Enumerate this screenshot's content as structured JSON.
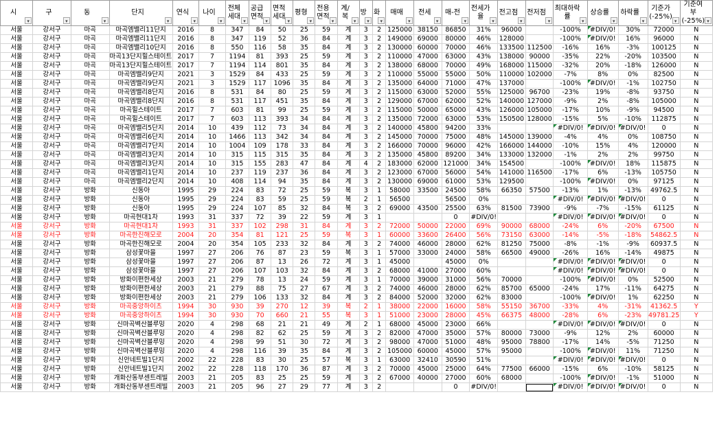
{
  "colors": {
    "red_row": "#ff1a1a",
    "error_marker": "#1e8a3b",
    "grid": "#d4d4d4"
  },
  "headers": [
    "시",
    "구",
    "동",
    "단지",
    "연식",
    "나이",
    "전체세대",
    "공급면적",
    "면적세대",
    "평형",
    "전용면적",
    "계/복",
    "방",
    "화",
    "매매",
    "전세",
    "매-전",
    "전세가율",
    "전고점",
    "전저점",
    "최대하락률",
    "상승률",
    "하락률",
    "기준가(-25%)",
    "기준여부(-25%)"
  ],
  "rows": [
    [
      "서울",
      "강서구",
      "마곡",
      "마곡엠밸리11단지",
      "2016",
      "8",
      "347",
      "84",
      "50",
      "25",
      "59",
      "계",
      "3",
      "2",
      "125000",
      "38150",
      "86850",
      "31%",
      "96000",
      "",
      "-100%",
      "#DIV/0!",
      "30%",
      "72000",
      "N"
    ],
    [
      "서울",
      "강서구",
      "마곡",
      "마곡엠밸리11단지",
      "2016",
      "8",
      "347",
      "119",
      "52",
      "36",
      "84",
      "계",
      "3",
      "2",
      "149000",
      "69000",
      "80000",
      "46%",
      "128000",
      "",
      "-100%",
      "#DIV/0!",
      "16%",
      "96000",
      "N"
    ],
    [
      "서울",
      "강서구",
      "마곡",
      "마곡엠밸리10단지",
      "2016",
      "8",
      "550",
      "116",
      "58",
      "35",
      "84",
      "계",
      "3",
      "2",
      "130000",
      "60000",
      "70000",
      "46%",
      "133500",
      "112500",
      "-16%",
      "16%",
      "-3%",
      "100125",
      "N"
    ],
    [
      "서울",
      "강서구",
      "마곡",
      "마곡13단지힐스테이트마스터",
      "2017",
      "7",
      "1194",
      "81",
      "393",
      "25",
      "59",
      "계",
      "3",
      "2",
      "110000",
      "47000",
      "63000",
      "43%",
      "138000",
      "90000",
      "-35%",
      "22%",
      "-20%",
      "103500",
      "N"
    ],
    [
      "서울",
      "강서구",
      "마곡",
      "마곡13단지힐스테이트마스터",
      "2017",
      "7",
      "1194",
      "114",
      "801",
      "35",
      "84",
      "계",
      "3",
      "2",
      "138000",
      "68000",
      "70000",
      "49%",
      "168000",
      "115000",
      "-32%",
      "20%",
      "-18%",
      "126000",
      "N"
    ],
    [
      "서울",
      "강서구",
      "마곡",
      "마곡엠밸리9단지",
      "2021",
      "3",
      "1529",
      "84",
      "433",
      "25",
      "59",
      "계",
      "3",
      "2",
      "110000",
      "55000",
      "55000",
      "50%",
      "110000",
      "102000",
      "-7%",
      "8%",
      "0%",
      "82500",
      "N"
    ],
    [
      "서울",
      "강서구",
      "마곡",
      "마곡엠밸리9단지",
      "2021",
      "3",
      "1529",
      "117",
      "1096",
      "35",
      "84",
      "계",
      "3",
      "2",
      "135000",
      "64000",
      "71000",
      "47%",
      "137000",
      "",
      "-100%",
      "#DIV/0!",
      "-1%",
      "102750",
      "N"
    ],
    [
      "서울",
      "강서구",
      "마곡",
      "마곡엠밸리8단지",
      "2016",
      "8",
      "531",
      "84",
      "80",
      "25",
      "59",
      "계",
      "3",
      "2",
      "115000",
      "63000",
      "52000",
      "55%",
      "125000",
      "96700",
      "-23%",
      "19%",
      "-8%",
      "93750",
      "N"
    ],
    [
      "서울",
      "강서구",
      "마곡",
      "마곡엠밸리8단지",
      "2016",
      "8",
      "531",
      "117",
      "451",
      "35",
      "84",
      "계",
      "3",
      "2",
      "129000",
      "67000",
      "62000",
      "52%",
      "140000",
      "127000",
      "-9%",
      "2%",
      "-8%",
      "105000",
      "N"
    ],
    [
      "서울",
      "강서구",
      "마곡",
      "마곡힐스테이트",
      "2017",
      "7",
      "603",
      "81",
      "99",
      "25",
      "59",
      "계",
      "3",
      "2",
      "115000",
      "50000",
      "65000",
      "43%",
      "126000",
      "105000",
      "-17%",
      "10%",
      "-9%",
      "94500",
      "N"
    ],
    [
      "서울",
      "강서구",
      "마곡",
      "마곡힐스테이트",
      "2017",
      "7",
      "603",
      "113",
      "393",
      "34",
      "84",
      "계",
      "3",
      "2",
      "135000",
      "72000",
      "63000",
      "53%",
      "150500",
      "128000",
      "-15%",
      "5%",
      "-10%",
      "112875",
      "N"
    ],
    [
      "서울",
      "강서구",
      "마곡",
      "마곡엠밸리5단지",
      "2014",
      "10",
      "439",
      "112",
      "73",
      "34",
      "84",
      "계",
      "3",
      "2",
      "140000",
      "45800",
      "94200",
      "33%",
      "",
      "",
      "#DIV/0!",
      "#DIV/0!",
      "#DIV/0!",
      "0",
      "N"
    ],
    [
      "서울",
      "강서구",
      "마곡",
      "마곡엠밸리6단지",
      "2014",
      "10",
      "1466",
      "113",
      "342",
      "34",
      "84",
      "계",
      "3",
      "2",
      "145000",
      "70000",
      "75000",
      "48%",
      "145000",
      "139000",
      "-4%",
      "4%",
      "0%",
      "108750",
      "N"
    ],
    [
      "서울",
      "강서구",
      "마곡",
      "마곡엠밸리7단지",
      "2014",
      "10",
      "1004",
      "109",
      "178",
      "33",
      "84",
      "계",
      "3",
      "2",
      "166000",
      "70000",
      "96000",
      "42%",
      "166000",
      "144000",
      "-10%",
      "15%",
      "4%",
      "120000",
      "N"
    ],
    [
      "서울",
      "강서구",
      "마곡",
      "마곡엠밸리3단지",
      "2014",
      "10",
      "315",
      "115",
      "315",
      "35",
      "84",
      "계",
      "3",
      "2",
      "135000",
      "45800",
      "89200",
      "34%",
      "133000",
      "132000",
      "-1%",
      "2%",
      "2%",
      "99750",
      "N"
    ],
    [
      "서울",
      "강서구",
      "마곡",
      "마곡엠밸리3단지",
      "2014",
      "10",
      "315",
      "155",
      "283",
      "47",
      "84",
      "계",
      "4",
      "2",
      "183000",
      "62000",
      "121000",
      "34%",
      "154500",
      "",
      "-100%",
      "#DIV/0!",
      "18%",
      "115875",
      "N"
    ],
    [
      "서울",
      "강서구",
      "마곡",
      "마곡엠밸리1단지",
      "2014",
      "10",
      "237",
      "119",
      "237",
      "36",
      "84",
      "계",
      "3",
      "2",
      "123000",
      "67000",
      "56000",
      "54%",
      "141000",
      "116500",
      "-17%",
      "6%",
      "-13%",
      "105750",
      "N"
    ],
    [
      "서울",
      "강서구",
      "마곡",
      "마곡엠밸리2단지",
      "2014",
      "10",
      "408",
      "114",
      "94",
      "35",
      "84",
      "계",
      "3",
      "2",
      "130000",
      "69000",
      "61000",
      "53%",
      "129500",
      "",
      "-100%",
      "#DIV/0!",
      "0%",
      "97125",
      "N"
    ],
    [
      "서울",
      "강서구",
      "방화",
      "신동아",
      "1995",
      "29",
      "224",
      "83",
      "72",
      "25",
      "59",
      "복",
      "3",
      "1",
      "58000",
      "33500",
      "24500",
      "58%",
      "66350",
      "57500",
      "-13%",
      "1%",
      "-13%",
      "49762.5",
      "N"
    ],
    [
      "서울",
      "강서구",
      "방화",
      "신동아",
      "1995",
      "29",
      "224",
      "83",
      "59",
      "25",
      "59",
      "복",
      "2",
      "1",
      "56500",
      "",
      "56500",
      "0%",
      "",
      "",
      "#DIV/0!",
      "#DIV/0!",
      "#DIV/0!",
      "0",
      "N"
    ],
    [
      "서울",
      "강서구",
      "방화",
      "신동아",
      "1995",
      "29",
      "224",
      "107",
      "85",
      "32",
      "84",
      "복",
      "3",
      "2",
      "69000",
      "43500",
      "25500",
      "63%",
      "81500",
      "73900",
      "-9%",
      "-7%",
      "-15%",
      "61125",
      "N"
    ],
    [
      "서울",
      "강서구",
      "방화",
      "마곡현대1차",
      "1993",
      "31",
      "337",
      "72",
      "39",
      "22",
      "59",
      "계",
      "3",
      "1",
      "",
      "",
      "0",
      "#DIV/0!",
      "",
      "",
      "#DIV/0!",
      "#DIV/0!",
      "#DIV/0!",
      "0",
      "N"
    ],
    [
      "서울",
      "강서구",
      "방화",
      "마곡현대1차",
      "1993",
      "31",
      "337",
      "102",
      "298",
      "31",
      "84",
      "계",
      "3",
      "2",
      "72000",
      "50000",
      "22000",
      "69%",
      "90000",
      "68000",
      "-24%",
      "6%",
      "-20%",
      "67500",
      "N"
    ],
    [
      "서울",
      "강서구",
      "방화",
      "마곡한진해모로",
      "2004",
      "20",
      "354",
      "81",
      "121",
      "25",
      "59",
      "복",
      "3",
      "1",
      "60000",
      "33600",
      "26400",
      "56%",
      "73150",
      "63000",
      "-14%",
      "-5%",
      "-18%",
      "54862.5",
      "N"
    ],
    [
      "서울",
      "강서구",
      "방화",
      "마곡한진해모로",
      "2004",
      "20",
      "354",
      "105",
      "233",
      "32",
      "84",
      "계",
      "3",
      "2",
      "74000",
      "46000",
      "28000",
      "62%",
      "81250",
      "75000",
      "-8%",
      "-1%",
      "-9%",
      "60937.5",
      "N"
    ],
    [
      "서울",
      "강서구",
      "방화",
      "삼성꽃마을",
      "1997",
      "27",
      "206",
      "76",
      "87",
      "23",
      "59",
      "복",
      "3",
      "1",
      "57000",
      "33000",
      "24000",
      "58%",
      "66500",
      "49000",
      "-26%",
      "16%",
      "-14%",
      "49875",
      "N"
    ],
    [
      "서울",
      "강서구",
      "방화",
      "삼성꽃마을",
      "1997",
      "27",
      "206",
      "87",
      "13",
      "26",
      "72",
      "계",
      "3",
      "1",
      "45000",
      "",
      "45000",
      "0%",
      "",
      "",
      "#DIV/0!",
      "#DIV/0!",
      "#DIV/0!",
      "0",
      "N"
    ],
    [
      "서울",
      "강서구",
      "방화",
      "삼성꽃마을",
      "1997",
      "27",
      "206",
      "107",
      "103",
      "32",
      "84",
      "계",
      "3",
      "2",
      "68000",
      "41000",
      "27000",
      "60%",
      "",
      "",
      "#DIV/0!",
      "#DIV/0!",
      "#DIV/0!",
      "0",
      "N"
    ],
    [
      "서울",
      "강서구",
      "방화",
      "방화이편한세상",
      "2003",
      "21",
      "279",
      "78",
      "13",
      "24",
      "59",
      "계",
      "3",
      "1",
      "70000",
      "39000",
      "31000",
      "56%",
      "70000",
      "",
      "-100%",
      "#DIV/0!",
      "0%",
      "52500",
      "N"
    ],
    [
      "서울",
      "강서구",
      "방화",
      "방화이편한세상",
      "2003",
      "21",
      "279",
      "88",
      "75",
      "27",
      "67",
      "계",
      "3",
      "2",
      "74000",
      "46000",
      "28000",
      "62%",
      "85700",
      "65000",
      "-24%",
      "17%",
      "-11%",
      "64275",
      "N"
    ],
    [
      "서울",
      "강서구",
      "방화",
      "방화이편한세상",
      "2003",
      "21",
      "279",
      "106",
      "133",
      "32",
      "84",
      "계",
      "3",
      "2",
      "84000",
      "52000",
      "32000",
      "62%",
      "83000",
      "",
      "-100%",
      "#DIV/0!",
      "1%",
      "62250",
      "N"
    ],
    [
      "서울",
      "강서구",
      "방화",
      "마곡중앙하이츠",
      "1994",
      "30",
      "930",
      "39",
      "270",
      "12",
      "39",
      "복",
      "2",
      "1",
      "38000",
      "22000",
      "16000",
      "58%",
      "55150",
      "36700",
      "-33%",
      "4%",
      "-31%",
      "41362.5",
      "Y"
    ],
    [
      "서울",
      "강서구",
      "방화",
      "마곡중앙하이츠",
      "1994",
      "30",
      "930",
      "70",
      "660",
      "21",
      "55",
      "복",
      "3",
      "1",
      "51000",
      "23000",
      "28000",
      "45%",
      "66375",
      "48000",
      "-28%",
      "6%",
      "-23%",
      "49781.25",
      "Y"
    ],
    [
      "서울",
      "강서구",
      "방화",
      "신마곡벽산블루밍",
      "2020",
      "4",
      "298",
      "68",
      "21",
      "21",
      "49",
      "계",
      "2",
      "1",
      "68000",
      "45000",
      "23000",
      "66%",
      "",
      "",
      "#DIV/0!",
      "#DIV/0!",
      "#DIV/0!",
      "0",
      "N"
    ],
    [
      "서울",
      "강서구",
      "방화",
      "신마곡벽산블루밍",
      "2020",
      "4",
      "298",
      "82",
      "62",
      "25",
      "59",
      "계",
      "3",
      "2",
      "82000",
      "47000",
      "35000",
      "57%",
      "80000",
      "73000",
      "-9%",
      "12%",
      "2%",
      "60000",
      "N"
    ],
    [
      "서울",
      "강서구",
      "방화",
      "신마곡벽산블루밍",
      "2020",
      "4",
      "298",
      "99",
      "51",
      "30",
      "72",
      "계",
      "3",
      "2",
      "98000",
      "47000",
      "51000",
      "48%",
      "95000",
      "78800",
      "-17%",
      "14%",
      "-5%",
      "71250",
      "N"
    ],
    [
      "서울",
      "강서구",
      "방화",
      "신마곡벽산블루밍",
      "2020",
      "4",
      "298",
      "116",
      "39",
      "35",
      "84",
      "계",
      "3",
      "2",
      "105000",
      "60000",
      "45000",
      "57%",
      "95000",
      "",
      "-100%",
      "#DIV/0!",
      "11%",
      "71250",
      "N"
    ],
    [
      "서울",
      "강서구",
      "방화",
      "신안네트빌1단지",
      "2002",
      "22",
      "228",
      "83",
      "30",
      "25",
      "57",
      "복",
      "3",
      "1",
      "63000",
      "32410",
      "30590",
      "51%",
      "",
      "",
      "#DIV/0!",
      "#DIV/0!",
      "#DIV/0!",
      "0",
      "N"
    ],
    [
      "서울",
      "강서구",
      "방화",
      "신안네트빌1단지",
      "2002",
      "22",
      "228",
      "118",
      "170",
      "36",
      "87",
      "계",
      "3",
      "2",
      "70000",
      "45000",
      "25000",
      "64%",
      "77500",
      "66000",
      "-15%",
      "6%",
      "-10%",
      "58125",
      "N"
    ],
    [
      "서울",
      "강서구",
      "방화",
      "개화산동부센트레빌",
      "2003",
      "21",
      "205",
      "83",
      "25",
      "25",
      "59",
      "계",
      "3",
      "2",
      "67000",
      "40000",
      "27000",
      "60%",
      "68000",
      "",
      "-100%",
      "#DIV/0!",
      "-1%",
      "51000",
      "N"
    ],
    [
      "서울",
      "강서구",
      "방화",
      "개화산동부센트레빌",
      "2003",
      "21",
      "205",
      "96",
      "27",
      "29",
      "77",
      "계",
      "3",
      "2",
      "",
      "",
      "0",
      "#DIV/0!",
      "",
      "",
      "#DIV/0!",
      "#DIV/0!",
      "#DIV/0!",
      "0",
      "N"
    ]
  ]
}
